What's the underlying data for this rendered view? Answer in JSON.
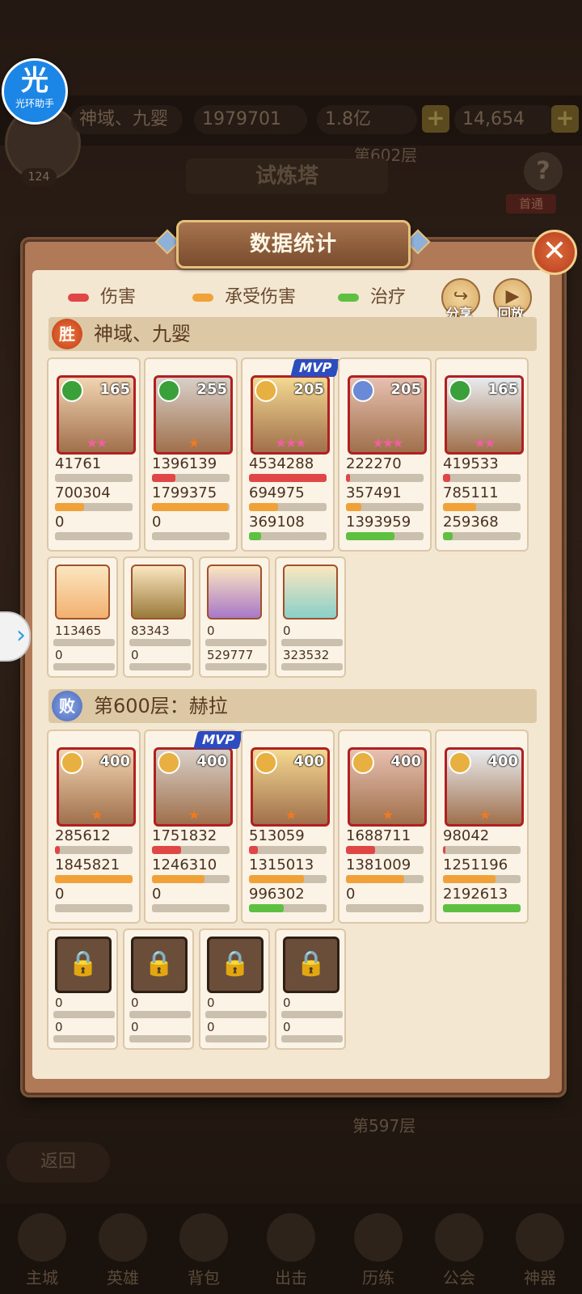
{
  "assistant_badge": {
    "glyph": "光",
    "label": "光环助手"
  },
  "background": {
    "player_level": "124",
    "player_name": "神域、九婴",
    "power": "1979701",
    "gold": "1.8亿",
    "gems": "14,654",
    "floor_top": "第602层",
    "tower_title": "试炼塔",
    "first_clear": "首通",
    "floor_bottom": "第597层",
    "back": "返回",
    "nav": [
      "主城",
      "英雄",
      "背包",
      "出击",
      "历练",
      "公会",
      "神器"
    ]
  },
  "panel": {
    "title": "数据统计",
    "legend": {
      "damage": "伤害",
      "taken": "承受伤害",
      "heal": "治疗"
    },
    "share": "分享",
    "replay": "回放",
    "colors": {
      "damage": "#e04646",
      "taken": "#f0a238",
      "heal": "#5ec040"
    }
  },
  "teams": [
    {
      "result": "胜",
      "name": "神域、九婴",
      "heroes": [
        {
          "level": "165",
          "stars": "★★",
          "mvp": false,
          "icon": "leaf-faction-icon",
          "damage": "41761",
          "taken": "700304",
          "heal": "0",
          "damage_pct": 0.0,
          "taken_pct": 0.38,
          "heal_pct": 0.0
        },
        {
          "level": "255",
          "stars": "★",
          "mvp": false,
          "icon": "leaf-faction-icon",
          "damage": "1396139",
          "taken": "1799375",
          "heal": "0",
          "damage_pct": 0.3,
          "taken_pct": 0.98,
          "heal_pct": 0.0
        },
        {
          "level": "205",
          "stars": "★★★",
          "mvp": true,
          "icon": "sun-faction-icon",
          "damage": "4534288",
          "taken": "694975",
          "heal": "369108",
          "damage_pct": 1.0,
          "taken_pct": 0.38,
          "heal_pct": 0.16
        },
        {
          "level": "205",
          "stars": "★★★",
          "mvp": false,
          "icon": "ice-faction-icon",
          "damage": "222270",
          "taken": "357491",
          "heal": "1393959",
          "damage_pct": 0.05,
          "taken_pct": 0.2,
          "heal_pct": 0.63
        },
        {
          "level": "165",
          "stars": "★★",
          "mvp": false,
          "icon": "leaf-faction-icon",
          "damage": "419533",
          "taken": "785111",
          "heal": "259368",
          "damage_pct": 0.09,
          "taken_pct": 0.43,
          "heal_pct": 0.12
        }
      ],
      "pets": [
        {
          "damage": "113465",
          "heal": "0",
          "damage_pct": 0.03,
          "heal_pct": 0.0,
          "locked": false
        },
        {
          "damage": "83343",
          "heal": "0",
          "damage_pct": 0.02,
          "heal_pct": 0.0,
          "locked": false
        },
        {
          "damage": "0",
          "heal": "529777",
          "damage_pct": 0.0,
          "heal_pct": 0.24,
          "locked": false
        },
        {
          "damage": "0",
          "heal": "323532",
          "damage_pct": 0.0,
          "heal_pct": 0.15,
          "locked": false
        }
      ]
    },
    {
      "result": "败",
      "name": "第600层：赫拉",
      "heroes": [
        {
          "level": "400",
          "stars": "★",
          "mvp": false,
          "icon": "sun-faction-icon",
          "damage": "285612",
          "taken": "1845821",
          "heal": "0",
          "damage_pct": 0.06,
          "taken_pct": 1.0,
          "heal_pct": 0.0
        },
        {
          "level": "400",
          "stars": "★",
          "mvp": true,
          "icon": "sun-faction-icon",
          "damage": "1751832",
          "taken": "1246310",
          "heal": "0",
          "damage_pct": 0.38,
          "taken_pct": 0.68,
          "heal_pct": 0.0
        },
        {
          "level": "400",
          "stars": "★",
          "mvp": false,
          "icon": "sun-faction-icon",
          "damage": "513059",
          "taken": "1315013",
          "heal": "996302",
          "damage_pct": 0.11,
          "taken_pct": 0.71,
          "heal_pct": 0.45
        },
        {
          "level": "400",
          "stars": "★",
          "mvp": false,
          "icon": "sun-faction-icon",
          "damage": "1688711",
          "taken": "1381009",
          "heal": "0",
          "damage_pct": 0.37,
          "taken_pct": 0.75,
          "heal_pct": 0.0
        },
        {
          "level": "400",
          "stars": "★",
          "mvp": false,
          "icon": "sun-faction-icon",
          "damage": "98042",
          "taken": "1251196",
          "heal": "2192613",
          "damage_pct": 0.02,
          "taken_pct": 0.68,
          "heal_pct": 1.0
        }
      ],
      "pets": [
        {
          "damage": "0",
          "heal": "0",
          "damage_pct": 0.0,
          "heal_pct": 0.0,
          "locked": true
        },
        {
          "damage": "0",
          "heal": "0",
          "damage_pct": 0.0,
          "heal_pct": 0.0,
          "locked": true
        },
        {
          "damage": "0",
          "heal": "0",
          "damage_pct": 0.0,
          "heal_pct": 0.0,
          "locked": true
        },
        {
          "damage": "0",
          "heal": "0",
          "damage_pct": 0.0,
          "heal_pct": 0.0,
          "locked": true
        }
      ]
    }
  ]
}
